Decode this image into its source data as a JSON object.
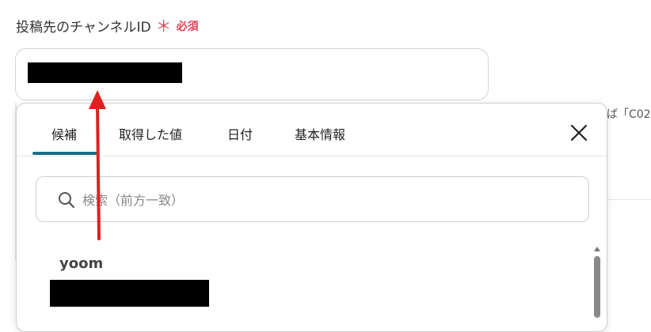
{
  "field": {
    "label": "投稿先のチャンネルID",
    "required_mark": "＊",
    "required_text": "必須"
  },
  "background_hint": "ば「C02",
  "popup": {
    "tabs": [
      {
        "label": "候補",
        "active": true
      },
      {
        "label": "取得した値",
        "active": false
      },
      {
        "label": "日付",
        "active": false
      },
      {
        "label": "基本情報",
        "active": false
      }
    ],
    "close_icon": "close-icon",
    "search": {
      "placeholder": "検索（前方一致）",
      "icon": "search-icon"
    },
    "options": [
      {
        "name": "yoom"
      }
    ]
  },
  "colors": {
    "required": "#e0455c",
    "tab_active_underline": "#1b6f86",
    "annotation_arrow": "#e02020"
  }
}
